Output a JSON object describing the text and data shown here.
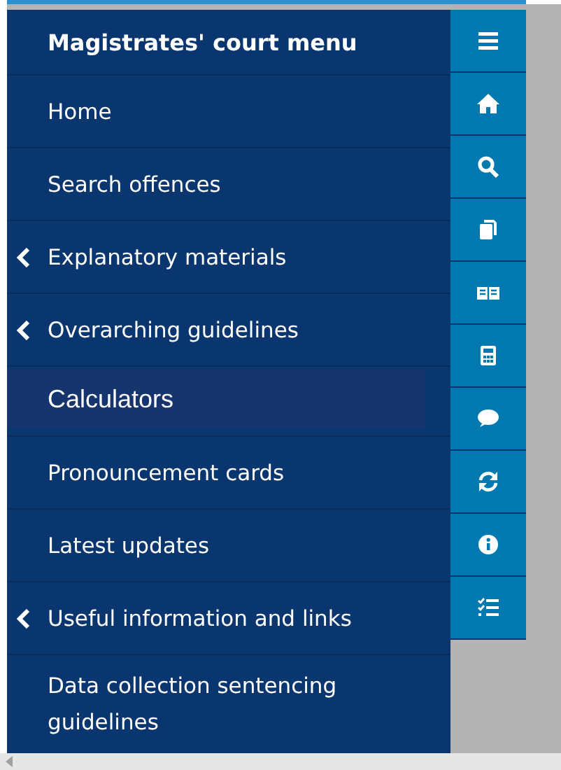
{
  "menu": {
    "title": "Magistrates' court menu",
    "items": [
      {
        "label": "Home",
        "has_submenu": false,
        "selected": false
      },
      {
        "label": "Search offences",
        "has_submenu": false,
        "selected": false
      },
      {
        "label": "Explanatory materials",
        "has_submenu": true,
        "selected": false
      },
      {
        "label": "Overarching guidelines",
        "has_submenu": true,
        "selected": false
      },
      {
        "label": "Calculators",
        "has_submenu": false,
        "selected": true
      },
      {
        "label": "Pronouncement cards",
        "has_submenu": false,
        "selected": false
      },
      {
        "label": "Latest updates",
        "has_submenu": false,
        "selected": false
      },
      {
        "label": "Useful information and links",
        "has_submenu": true,
        "selected": false
      },
      {
        "label": "Data collection sentencing guidelines",
        "has_submenu": false,
        "selected": false
      }
    ]
  }
}
